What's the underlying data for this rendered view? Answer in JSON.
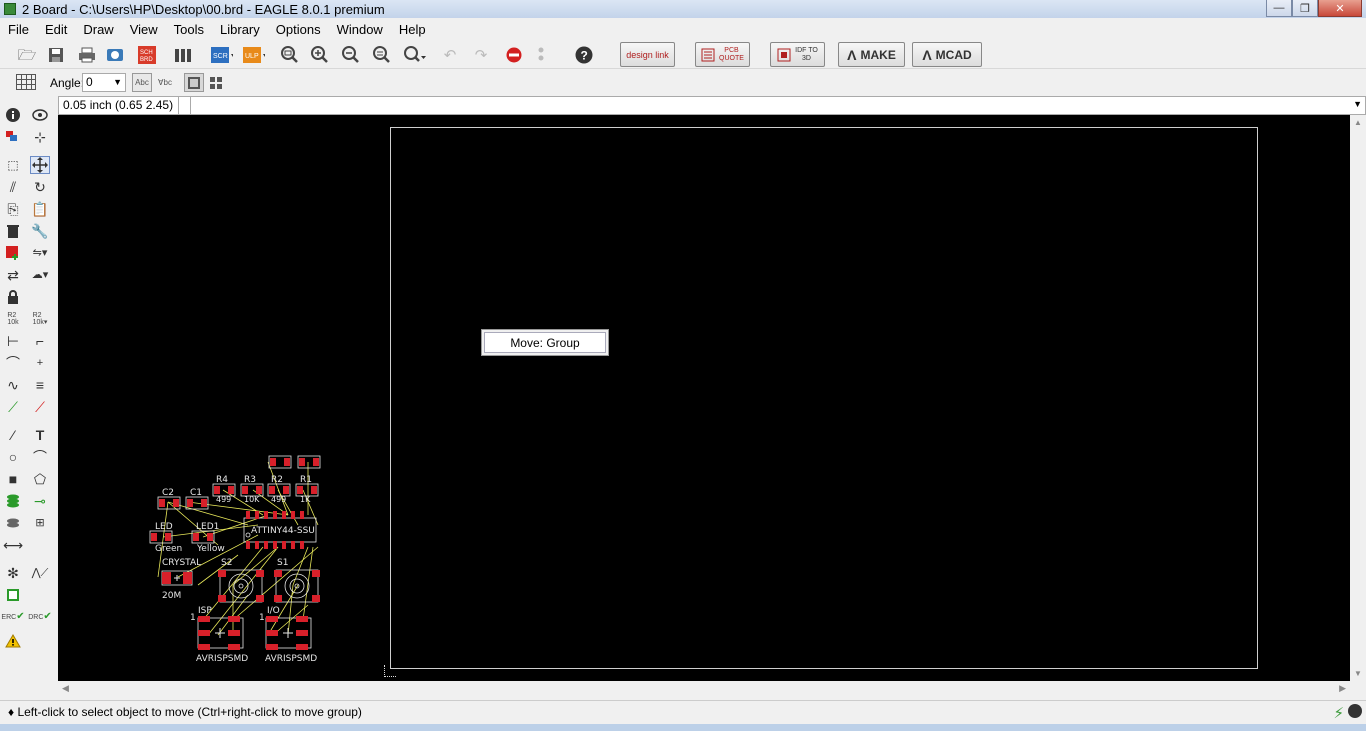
{
  "window": {
    "title": "2 Board - C:\\Users\\HP\\Desktop\\00.brd - EAGLE 8.0.1 premium",
    "minimize_glyph": "—",
    "maximize_glyph": "❐",
    "close_glyph": "✕"
  },
  "menu": [
    "File",
    "Edit",
    "Draw",
    "View",
    "Tools",
    "Library",
    "Options",
    "Window",
    "Help"
  ],
  "toolbar": {
    "design_link": "design link",
    "pcb_quote": "PCB QUOTE",
    "idf": "IDF TO 3D",
    "make": "MAKE",
    "mcad": "MCAD",
    "help_glyph": "?"
  },
  "params": {
    "angle_label": "Angle:",
    "angle_value": "0"
  },
  "coord": {
    "display": "0.05 inch (0.65 2.45)"
  },
  "popup": {
    "label": "Move: Group"
  },
  "status": {
    "text": "♦ Left-click to select object to move (Ctrl+right-click to move group)"
  },
  "pcb_labels": {
    "r4": "R4",
    "r4v": "499",
    "r3": "R3",
    "r3v": "10K",
    "r2": "R2",
    "r2v": "499",
    "r1": "R1",
    "r1v": "1K",
    "c2": "C2",
    "c1": "C1",
    "led": "LED",
    "ledv": "Green",
    "led1": "LED1",
    "led1v": "Yellow",
    "ic": "ATTINY44-SSU",
    "crystal": "CRYSTAL",
    "crystalv": "20M",
    "s2": "S2",
    "s1": "S1",
    "isp": "ISP",
    "io": "I/O",
    "isp_pin": "1",
    "io_pin": "1",
    "avr1": "AVRISPSMD",
    "avr2": "AVRISPSMD"
  },
  "colors": {
    "canvas_bg": "#000000",
    "pad": "#d8202a",
    "airwire": "#e8e85a",
    "silk": "#e6e6e6",
    "outline": "#cfcfcf"
  }
}
